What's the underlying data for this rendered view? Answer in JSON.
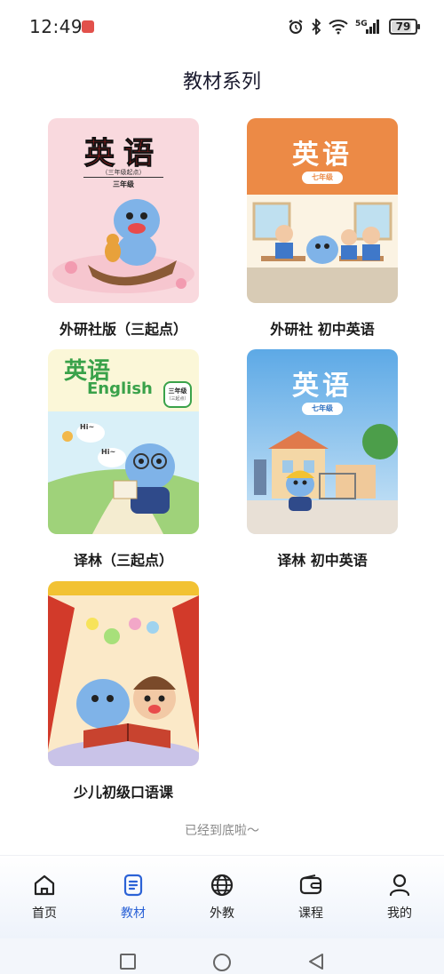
{
  "status_bar": {
    "time": "12:49",
    "battery": "79",
    "network": "5G"
  },
  "page": {
    "title": "教材系列",
    "end_text": "已经到底啦～"
  },
  "books": [
    {
      "name": "外研社版（三起点）",
      "cover_title": "英语",
      "cover_sub": "（三年级起点）",
      "cover_grade": "三年级"
    },
    {
      "name": "外研社 初中英语",
      "cover_title": "英语",
      "cover_grade": "七年级"
    },
    {
      "name": "译林（三起点）",
      "cover_title": "英语",
      "cover_english": "English",
      "cover_grade": "三年级",
      "cover_badge_sub": "（三起点）",
      "cover_bubble_1": "Hi~",
      "cover_bubble_2": "Hi~"
    },
    {
      "name": "译林 初中英语",
      "cover_title": "英语",
      "cover_grade": "七年级"
    },
    {
      "name": "少儿初级口语课"
    }
  ],
  "nav": {
    "items": [
      {
        "label": "首页",
        "icon": "home-icon"
      },
      {
        "label": "教材",
        "icon": "book-icon",
        "active": true
      },
      {
        "label": "外教",
        "icon": "globe-icon"
      },
      {
        "label": "课程",
        "icon": "wallet-icon"
      },
      {
        "label": "我的",
        "icon": "user-icon"
      }
    ]
  },
  "colors": {
    "accent": "#2b62d6",
    "text": "#1a1a1a",
    "muted": "#8a8a8a"
  }
}
